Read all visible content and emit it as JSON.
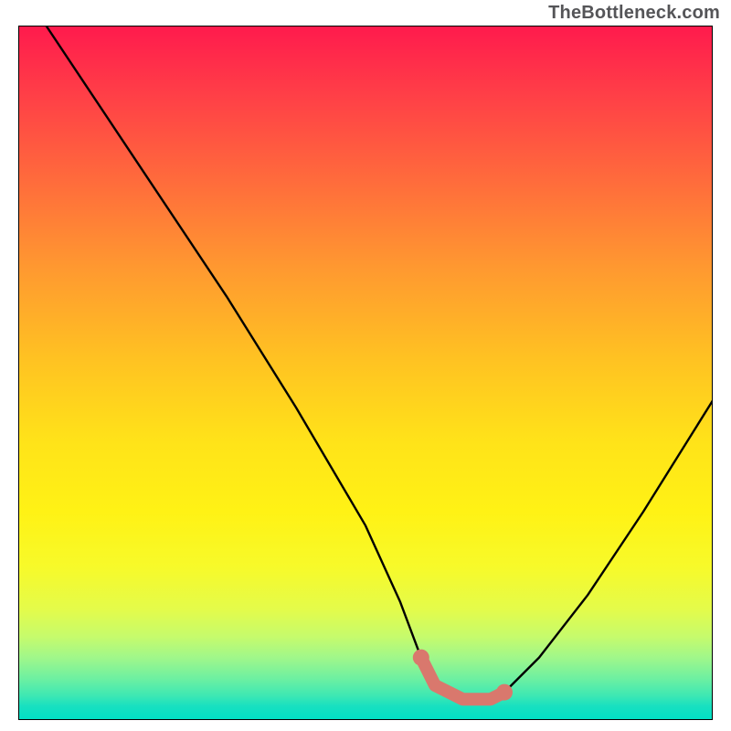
{
  "watermark": "TheBottleneck.com",
  "chart_data": {
    "type": "line",
    "title": "",
    "xlabel": "",
    "ylabel": "",
    "xlim": [
      0,
      100
    ],
    "ylim": [
      0,
      100
    ],
    "curve": {
      "name": "bottleneck-curve",
      "x": [
        4,
        10,
        20,
        30,
        40,
        50,
        55,
        58,
        60,
        64,
        68,
        70,
        75,
        82,
        90,
        100
      ],
      "y": [
        100,
        91,
        76,
        61,
        45,
        28,
        17,
        9,
        5,
        3,
        3,
        4,
        9,
        18,
        30,
        46
      ]
    },
    "highlight_band": {
      "name": "optimal-range",
      "color": "#d9786d",
      "x": [
        58,
        60,
        64,
        68,
        70
      ],
      "y": [
        9,
        5,
        3,
        3,
        4
      ]
    },
    "background_gradient": {
      "stops": [
        {
          "pos": 0.0,
          "color": "#ff1a4d"
        },
        {
          "pos": 0.5,
          "color": "#ffcf20"
        },
        {
          "pos": 0.8,
          "color": "#f0fa30"
        },
        {
          "pos": 1.0,
          "color": "#00e0c5"
        }
      ]
    }
  }
}
